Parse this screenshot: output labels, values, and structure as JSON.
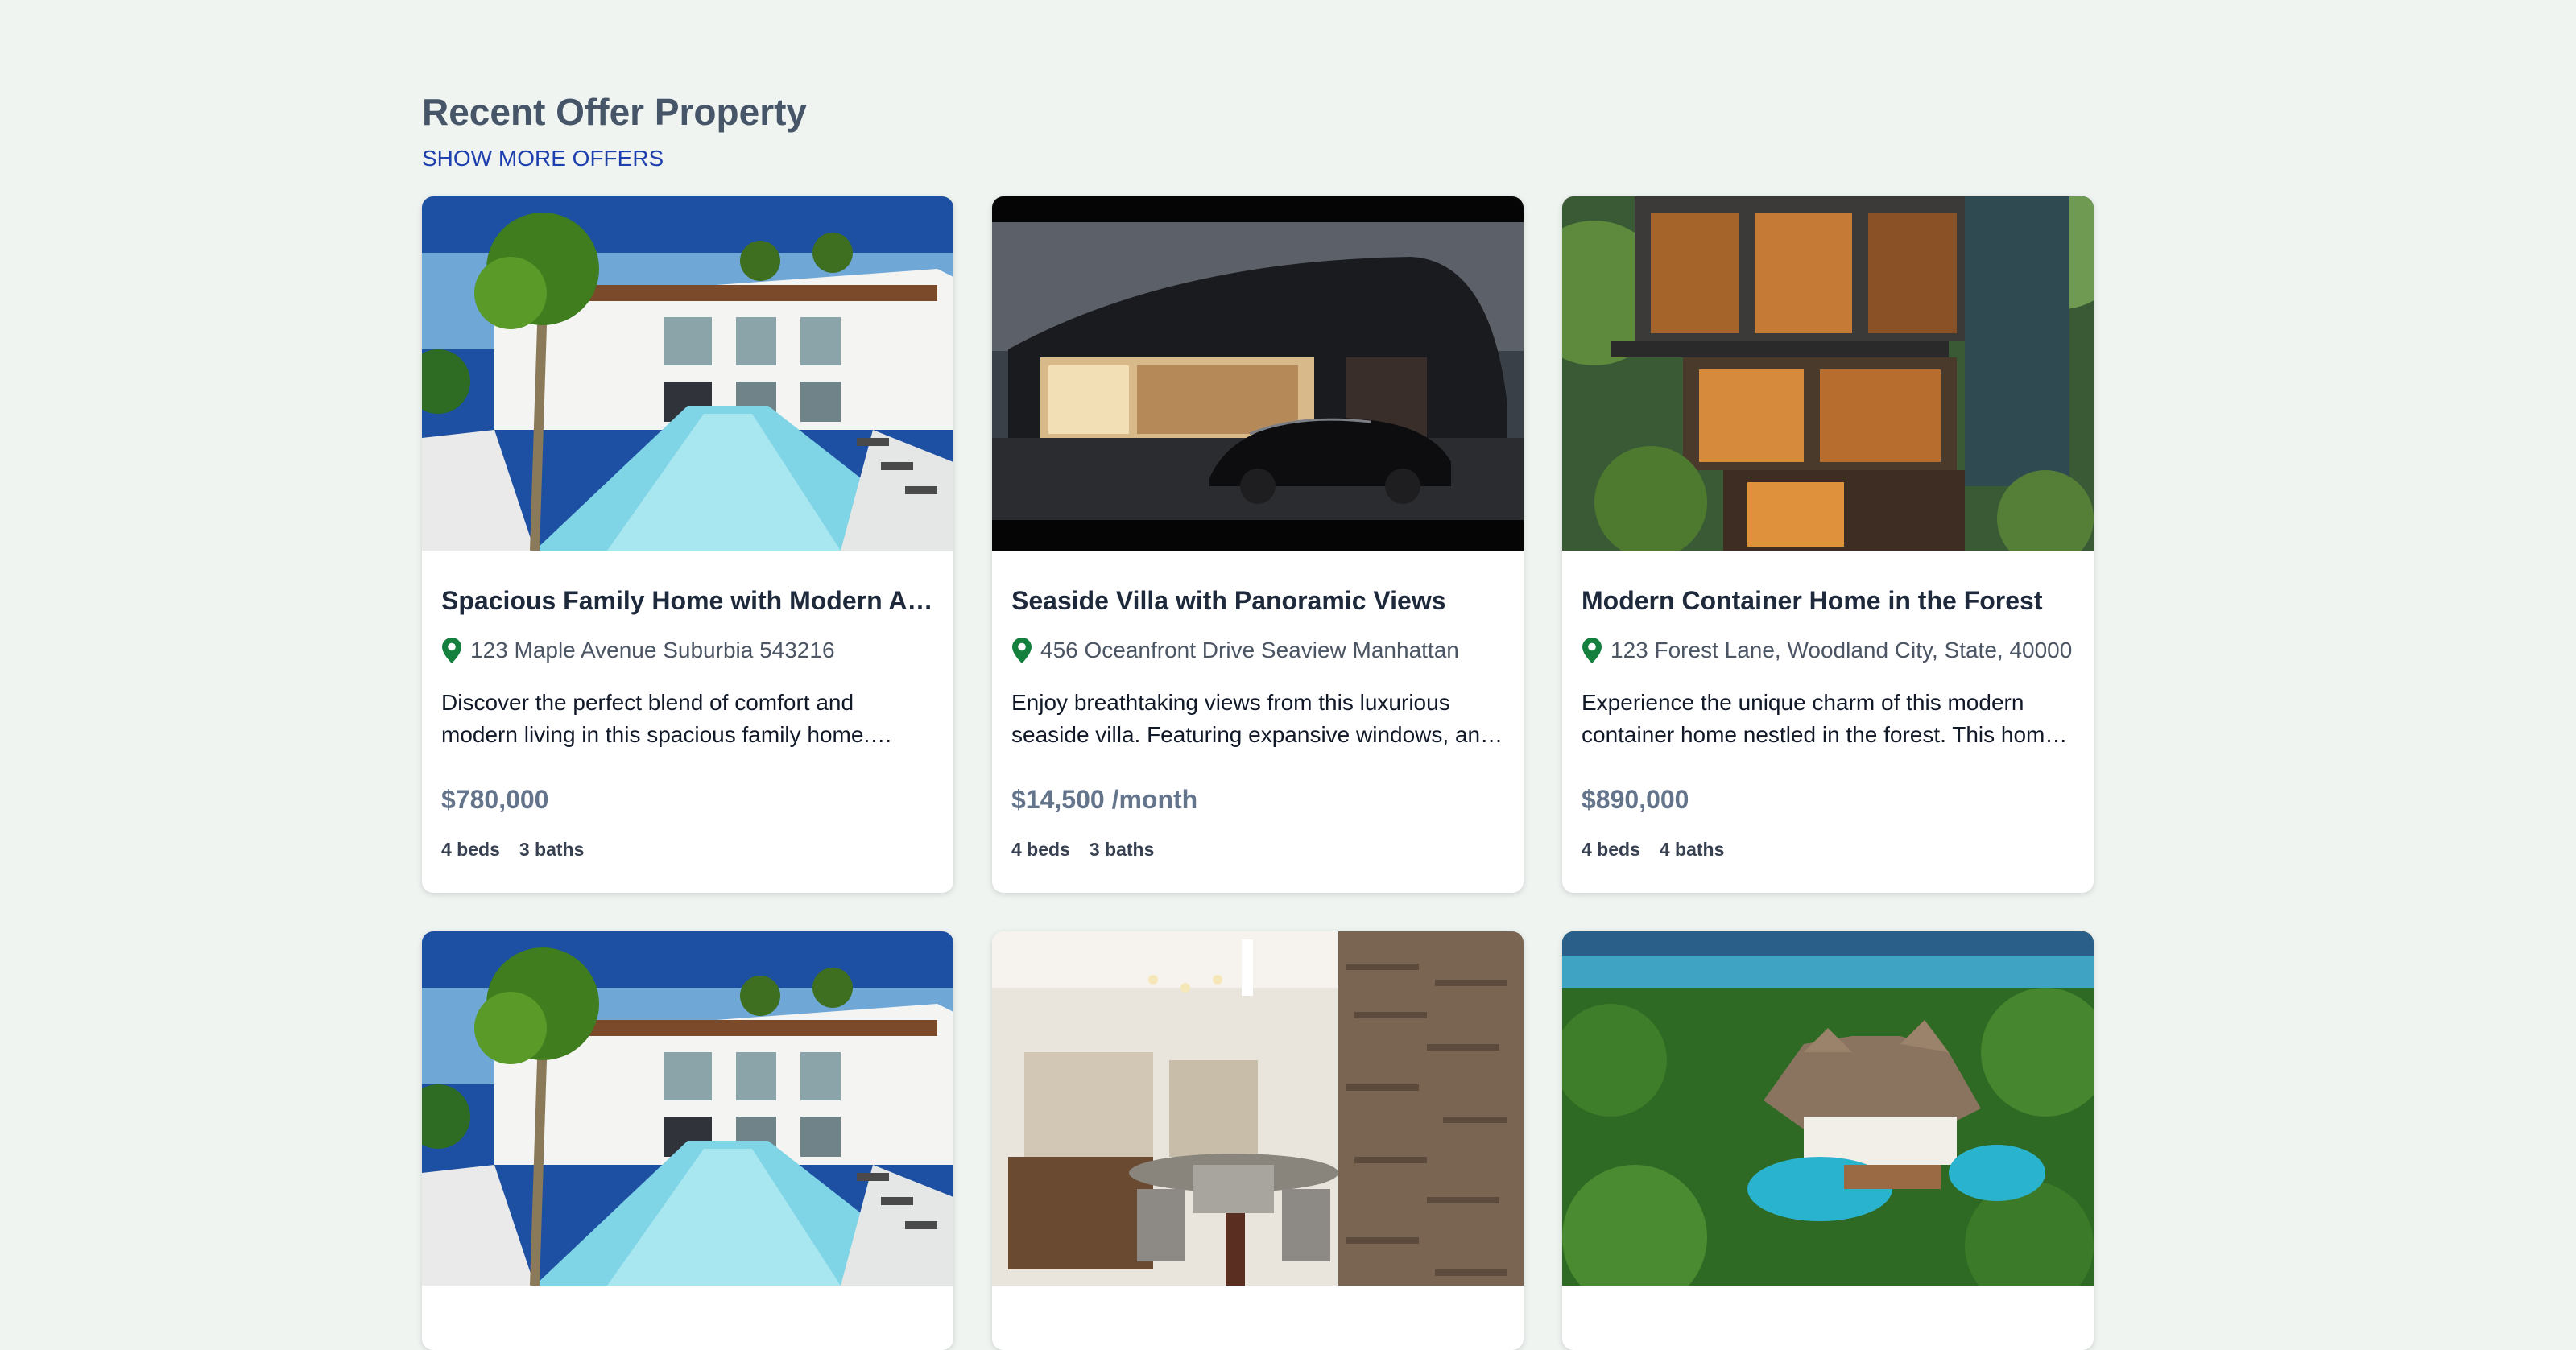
{
  "section": {
    "title": "Recent Offer Property",
    "more_link": "SHOW MORE OFFERS"
  },
  "colors": {
    "background": "#eff4f1",
    "heading": "#475569",
    "link": "#1e40af",
    "pin": "#15803d",
    "price": "#64748b"
  },
  "listings": [
    {
      "title": "Spacious Family Home with Modern Amenities",
      "address": "123 Maple Avenue Suburbia 543216",
      "description": "Discover the perfect blend of comfort and modern living in this spacious family home. Featuring an open floor plan and a private pool.",
      "price": "$780,000",
      "beds": "4 beds",
      "baths": "3 baths",
      "image": "white-villa-pool-palms"
    },
    {
      "title": "Seaside Villa with Panoramic Views",
      "address": "456 Oceanfront Drive Seaview Manhattan",
      "description": "Enjoy breathtaking views from this luxurious seaside villa. Featuring expansive windows, and a modern design.",
      "price": "$14,500 /month",
      "beds": "4 beds",
      "baths": "3 baths",
      "image": "modern-house-night-car"
    },
    {
      "title": "Modern Container Home in the Forest",
      "address": "123 Forest Lane, Woodland City, State, 40000",
      "description": "Experience the unique charm of this modern container home nestled in the forest. This home offers a peaceful retreat.",
      "price": "$890,000",
      "beds": "4 beds",
      "baths": "4 baths",
      "image": "container-home-forest"
    },
    {
      "image": "white-villa-pool-palms"
    },
    {
      "image": "dining-room-brick-wall"
    },
    {
      "image": "tropical-resort-aerial"
    }
  ]
}
